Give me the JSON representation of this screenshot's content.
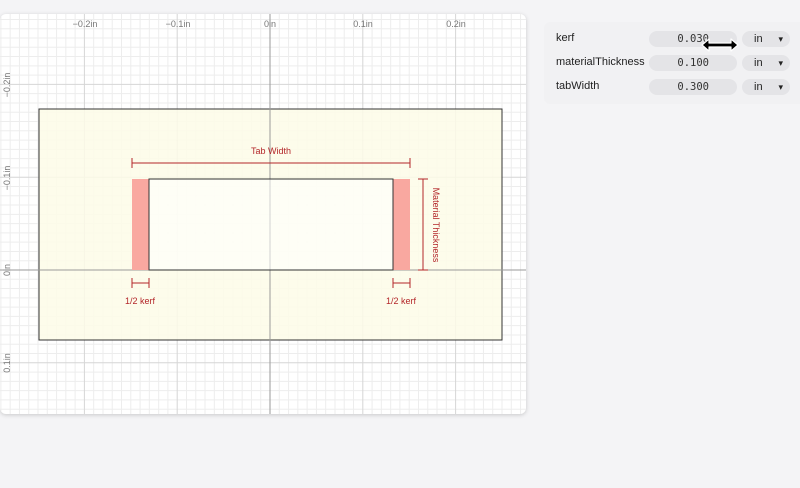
{
  "canvas": {
    "x_ticks": [
      "−0.2in",
      "−0.1in",
      "0in",
      "0.1in",
      "0.2in"
    ],
    "y_ticks": [
      "−0.2in",
      "−0.1in",
      "0in",
      "0.1in"
    ],
    "annotations": {
      "tab_width": "Tab Width",
      "material_thickness": "Material Thickness",
      "half_kerf_left": "1/2 kerf",
      "half_kerf_right": "1/2 kerf"
    },
    "colors": {
      "stock_fill": "#fdfbe7",
      "kerf_fill": "#f9a8a0",
      "dimension": "#b3262a",
      "outline": "#333333",
      "grid_minor": "#ececec",
      "grid_major": "#d6d6d6",
      "axis": "#9a9a9a"
    }
  },
  "parameters": [
    {
      "name": "kerf",
      "value": "0.030",
      "unit": "in"
    },
    {
      "name": "materialThickness",
      "value": "0.100",
      "unit": "in"
    },
    {
      "name": "tabWidth",
      "value": "0.300",
      "unit": "in"
    }
  ],
  "icons": {
    "unit_dropdown": "chevron-down-icon",
    "cursor": "resize-horizontal-cursor-icon"
  }
}
